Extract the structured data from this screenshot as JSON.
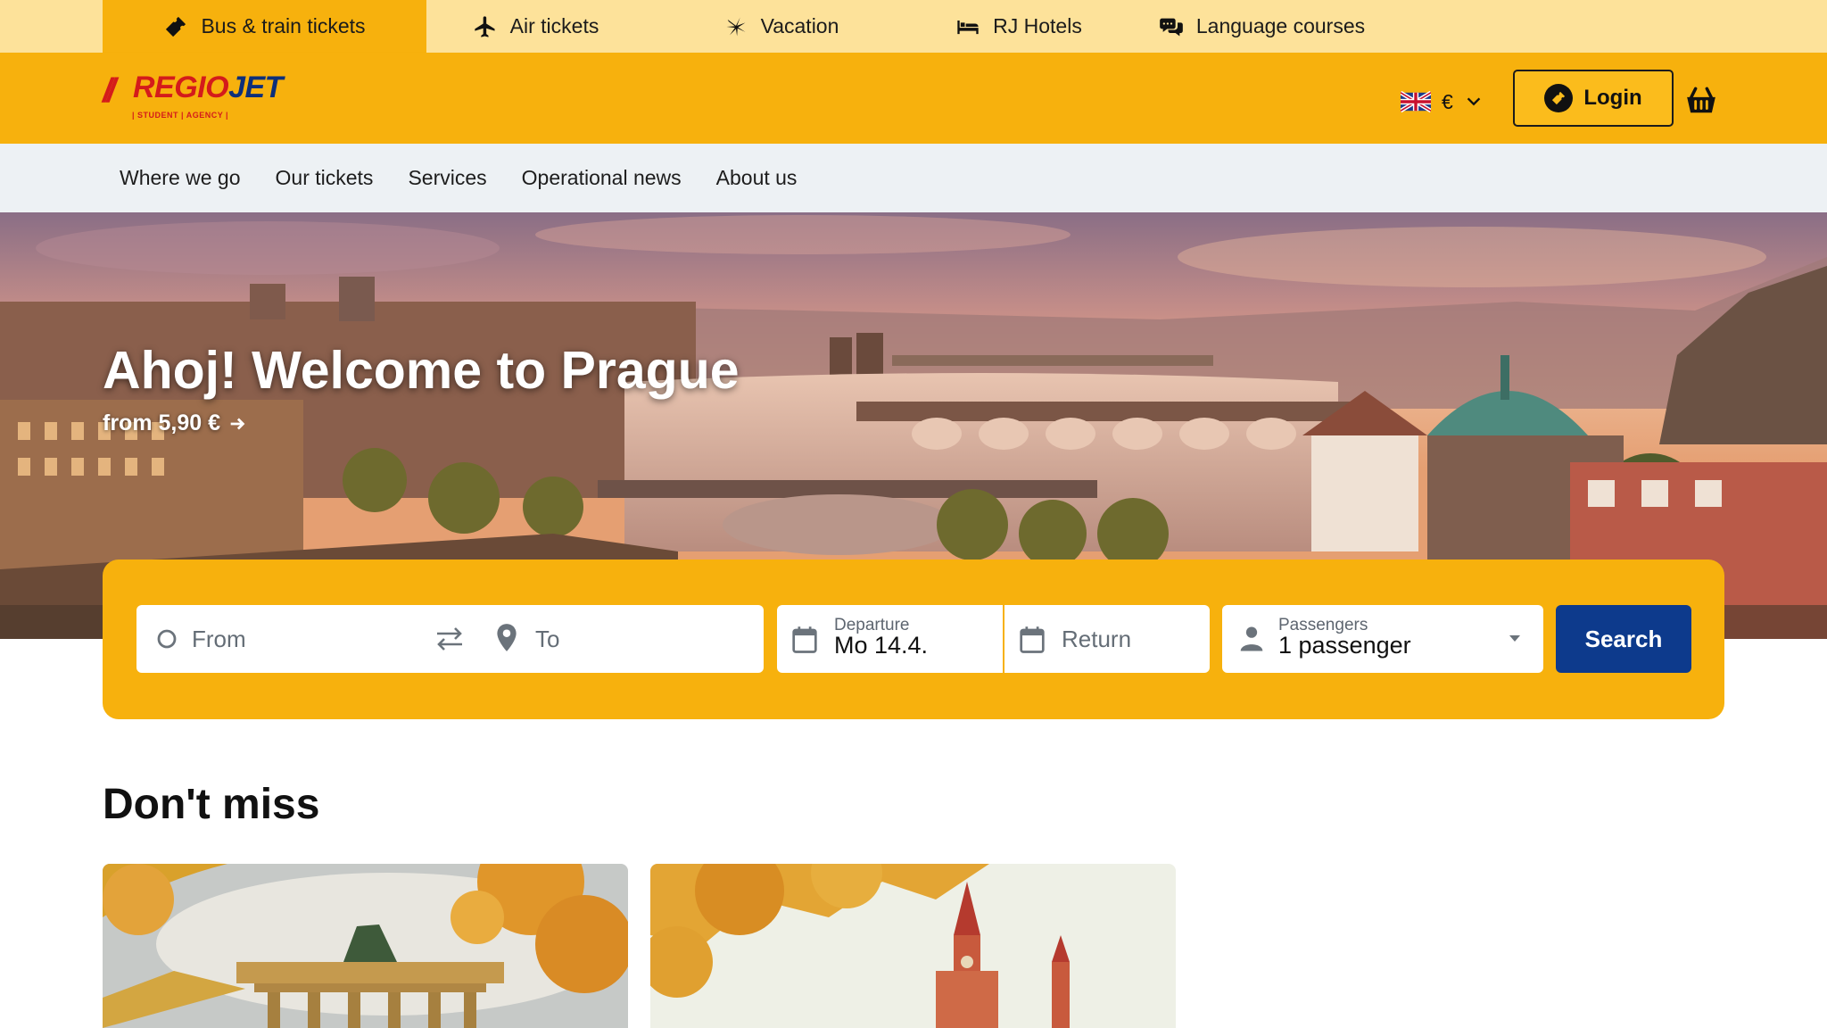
{
  "product_tabs": [
    {
      "label": "Bus & train tickets",
      "icon": "ticket-icon",
      "active": true
    },
    {
      "label": "Air tickets",
      "icon": "airplane-icon",
      "active": false
    },
    {
      "label": "Vacation",
      "icon": "palm-tree-icon",
      "active": false
    },
    {
      "label": "RJ Hotels",
      "icon": "bed-icon",
      "active": false
    },
    {
      "label": "Language courses",
      "icon": "chat-bubbles-icon",
      "active": false
    }
  ],
  "header": {
    "logo": {
      "mark": "//",
      "brand_regio": "REGIO",
      "brand_jet": "JET",
      "sub": "| STUDENT | AGENCY |"
    },
    "currency": "€",
    "language_flag": "uk-flag-icon",
    "login_label": "Login",
    "cart_icon": "basket-icon"
  },
  "subnav": {
    "items": [
      "Where we go",
      "Our tickets",
      "Services",
      "Operational news",
      "About us"
    ]
  },
  "hero": {
    "title": "Ahoj! Welcome to Prague",
    "price": "from 5,90 €"
  },
  "search": {
    "from_placeholder": "From",
    "to_placeholder": "To",
    "departure_label": "Departure",
    "departure_value": "Mo 14.4.",
    "return_placeholder": "Return",
    "passengers_label": "Passengers",
    "passengers_value": "1 passenger",
    "button_label": "Search"
  },
  "dont_miss": {
    "title": "Don't miss"
  },
  "colors": {
    "brand_yellow": "#f7b10d",
    "strip_yellow": "#fde29a",
    "subnav_bg": "#edf1f4",
    "brand_blue": "#0d3a8c",
    "brand_red": "#d41b1b"
  }
}
